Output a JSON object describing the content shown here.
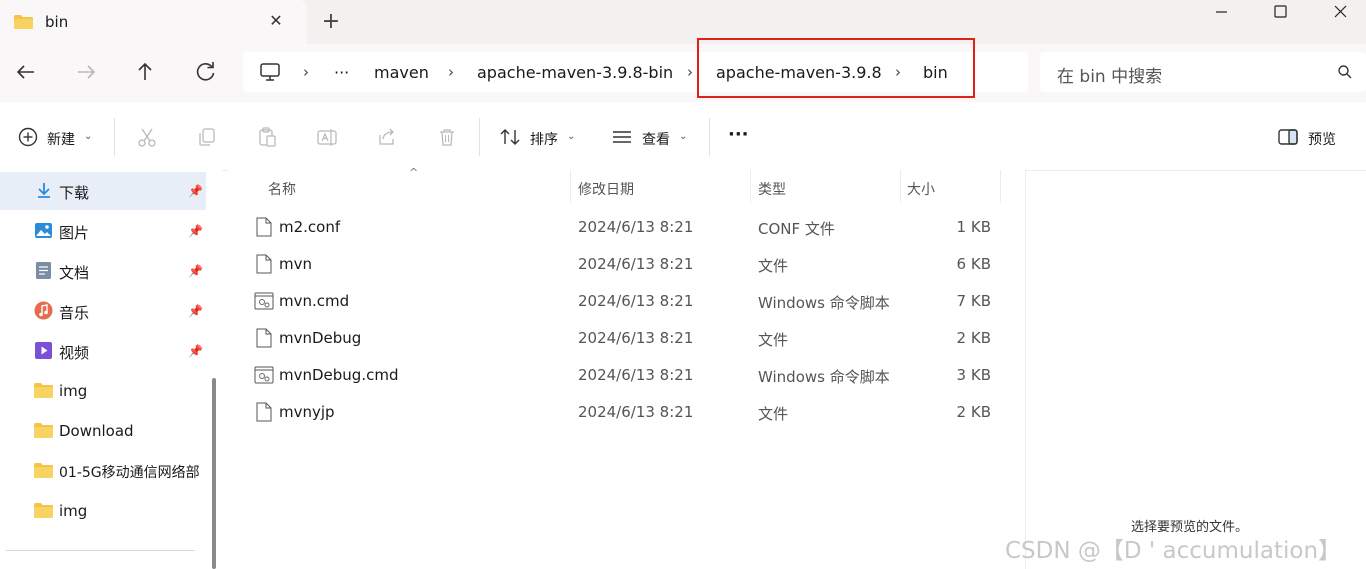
{
  "window": {
    "tab_title": "bin",
    "tab_close": "✕",
    "new_tab": "+"
  },
  "nav": {
    "breadcrumbs": [
      "maven",
      "apache-maven-3.9.8-bin",
      "apache-maven-3.9.8",
      "bin"
    ],
    "more": "···",
    "search_placeholder": "在 bin 中搜索"
  },
  "toolbar": {
    "new_label": "新建",
    "sort_label": "排序",
    "view_label": "查看",
    "more": "···",
    "preview_label": "预览"
  },
  "sidebar": {
    "items": [
      {
        "label": "下载",
        "icon": "download-icon",
        "pinned": true,
        "selected": true
      },
      {
        "label": "图片",
        "icon": "pictures-icon",
        "pinned": true
      },
      {
        "label": "文档",
        "icon": "documents-icon",
        "pinned": true
      },
      {
        "label": "音乐",
        "icon": "music-icon",
        "pinned": true
      },
      {
        "label": "视频",
        "icon": "videos-icon",
        "pinned": true
      },
      {
        "label": "img",
        "icon": "folder-icon",
        "pinned": false
      },
      {
        "label": "Download",
        "icon": "folder-icon",
        "pinned": false
      },
      {
        "label": "01-5G移动通信网络部",
        "icon": "folder-icon",
        "pinned": false
      },
      {
        "label": "img",
        "icon": "folder-icon",
        "pinned": false
      }
    ]
  },
  "columns": {
    "name": "名称",
    "date": "修改日期",
    "type": "类型",
    "size": "大小"
  },
  "files": [
    {
      "name": "m2.conf",
      "date": "2024/6/13 8:21",
      "type": "CONF 文件",
      "size": "1 KB",
      "icon": "file-icon"
    },
    {
      "name": "mvn",
      "date": "2024/6/13 8:21",
      "type": "文件",
      "size": "6 KB",
      "icon": "file-icon"
    },
    {
      "name": "mvn.cmd",
      "date": "2024/6/13 8:21",
      "type": "Windows 命令脚本",
      "size": "7 KB",
      "icon": "cmd-file-icon"
    },
    {
      "name": "mvnDebug",
      "date": "2024/6/13 8:21",
      "type": "文件",
      "size": "2 KB",
      "icon": "file-icon"
    },
    {
      "name": "mvnDebug.cmd",
      "date": "2024/6/13 8:21",
      "type": "Windows 命令脚本",
      "size": "3 KB",
      "icon": "cmd-file-icon"
    },
    {
      "name": "mvnyjp",
      "date": "2024/6/13 8:21",
      "type": "文件",
      "size": "2 KB",
      "icon": "file-icon"
    }
  ],
  "preview": {
    "empty_text": "选择要预览的文件。"
  },
  "watermark": "CSDN @【D ' accumulation】",
  "colors": {
    "highlight_box": "#e0201b",
    "folder": "#f4c542",
    "selection": "#e8eef8"
  }
}
